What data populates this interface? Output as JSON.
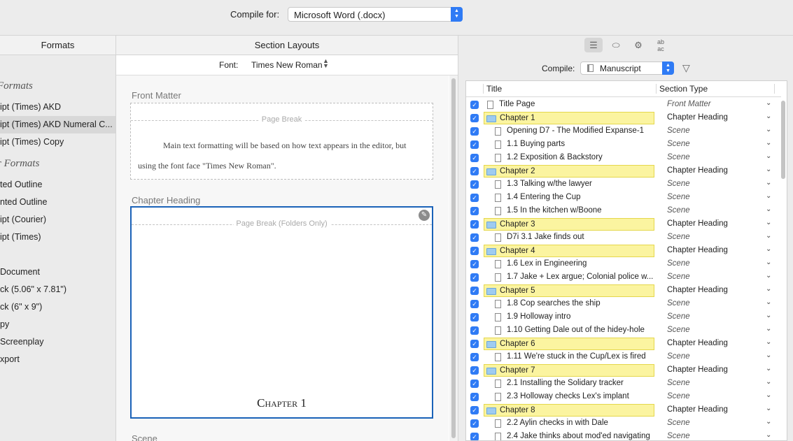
{
  "compile_for": {
    "label": "Compile for:",
    "value": "Microsoft Word (.docx)"
  },
  "left_panel": {
    "header": "Formats",
    "items": [
      {
        "kind": "heading",
        "text": "Formats"
      },
      {
        "kind": "item",
        "text": "ipt (Times) AKD"
      },
      {
        "kind": "item",
        "text": "ipt (Times) AKD Numeral C...",
        "selected": true
      },
      {
        "kind": "item",
        "text": "ipt (Times) Copy"
      },
      {
        "kind": "heading",
        "text": "r Formats"
      },
      {
        "kind": "item",
        "text": "ted Outline"
      },
      {
        "kind": "item",
        "text": "nted Outline"
      },
      {
        "kind": "item",
        "text": "ipt (Courier)"
      },
      {
        "kind": "item",
        "text": "ipt (Times)"
      },
      {
        "kind": "item",
        "text": ""
      },
      {
        "kind": "item",
        "text": "Document"
      },
      {
        "kind": "item",
        "text": "ck (5.06\" x 7.81\")"
      },
      {
        "kind": "item",
        "text": "ck (6\" x 9\")"
      },
      {
        "kind": "item",
        "text": "py"
      },
      {
        "kind": "item",
        "text": "Screenplay"
      },
      {
        "kind": "item",
        "text": "xport"
      }
    ]
  },
  "middle_panel": {
    "header": "Section Layouts",
    "font_label": "Font:",
    "font_value": "Times New Roman",
    "front_matter": {
      "label": "Front Matter",
      "page_break": "Page Break",
      "text": "Main text formatting will be based on how text appears in the editor, but using the font face \"Times New Roman\"."
    },
    "chapter_heading": {
      "label": "Chapter Heading",
      "page_break": "Page Break (Folders Only)",
      "title": "Chapter 1"
    },
    "scene": {
      "label": "Scene"
    }
  },
  "right_panel": {
    "compile_label": "Compile:",
    "compile_value": "Manuscript",
    "columns": {
      "title": "Title",
      "section_type": "Section Type"
    },
    "rows": [
      {
        "title": "Title Page",
        "type": "Front Matter",
        "kind": "doc",
        "level": 0
      },
      {
        "title": "Chapter 1",
        "type": "Chapter Heading",
        "kind": "folder",
        "level": 0
      },
      {
        "title": "Opening D7 - The Modified Expanse-1",
        "type": "Scene",
        "kind": "doc",
        "level": 1
      },
      {
        "title": "1.1 Buying parts",
        "type": "Scene",
        "kind": "doc",
        "level": 1
      },
      {
        "title": "1.2 Exposition & Backstory",
        "type": "Scene",
        "kind": "doc",
        "level": 1
      },
      {
        "title": "Chapter 2",
        "type": "Chapter Heading",
        "kind": "folder",
        "level": 0
      },
      {
        "title": "1.3 Talking w/the lawyer",
        "type": "Scene",
        "kind": "doc",
        "level": 1
      },
      {
        "title": "1.4 Entering the Cup",
        "type": "Scene",
        "kind": "doc",
        "level": 1
      },
      {
        "title": "1.5 In the kitchen w/Boone",
        "type": "Scene",
        "kind": "doc",
        "level": 1
      },
      {
        "title": "Chapter 3",
        "type": "Chapter Heading",
        "kind": "folder",
        "level": 0
      },
      {
        "title": "D7i 3.1 Jake finds out",
        "type": "Scene",
        "kind": "doc",
        "level": 1
      },
      {
        "title": "Chapter 4",
        "type": "Chapter Heading",
        "kind": "folder",
        "level": 0
      },
      {
        "title": "1.6 Lex in Engineering",
        "type": "Scene",
        "kind": "doc",
        "level": 1
      },
      {
        "title": "1.7 Jake + Lex argue; Colonial police w...",
        "type": "Scene",
        "kind": "doc",
        "level": 1
      },
      {
        "title": "Chapter 5",
        "type": "Chapter Heading",
        "kind": "folder",
        "level": 0
      },
      {
        "title": "1.8 Cop searches the ship",
        "type": "Scene",
        "kind": "doc",
        "level": 1
      },
      {
        "title": "1.9 Holloway intro",
        "type": "Scene",
        "kind": "doc",
        "level": 1
      },
      {
        "title": "1.10 Getting Dale out of the hidey-hole",
        "type": "Scene",
        "kind": "doc",
        "level": 1
      },
      {
        "title": "Chapter 6",
        "type": "Chapter Heading",
        "kind": "folder",
        "level": 0
      },
      {
        "title": "1.11 We're stuck in the Cup/Lex is fired",
        "type": "Scene",
        "kind": "doc",
        "level": 1
      },
      {
        "title": "Chapter 7",
        "type": "Chapter Heading",
        "kind": "folder",
        "level": 0
      },
      {
        "title": "2.1 Installing the Solidary tracker",
        "type": "Scene",
        "kind": "doc",
        "level": 1
      },
      {
        "title": "2.3 Holloway checks Lex's implant",
        "type": "Scene",
        "kind": "doc",
        "level": 1
      },
      {
        "title": "Chapter 8",
        "type": "Chapter Heading",
        "kind": "folder",
        "level": 0
      },
      {
        "title": "2.2 Aylin checks in with Dale",
        "type": "Scene",
        "kind": "doc",
        "level": 1
      },
      {
        "title": "2.4 Jake thinks about mod'ed navigating",
        "type": "Scene",
        "kind": "doc",
        "level": 1
      }
    ]
  },
  "colors": {
    "accent": "#2f7bf5",
    "folder_highlight": "#fbf4a0",
    "selection_border": "#1a62b8"
  }
}
